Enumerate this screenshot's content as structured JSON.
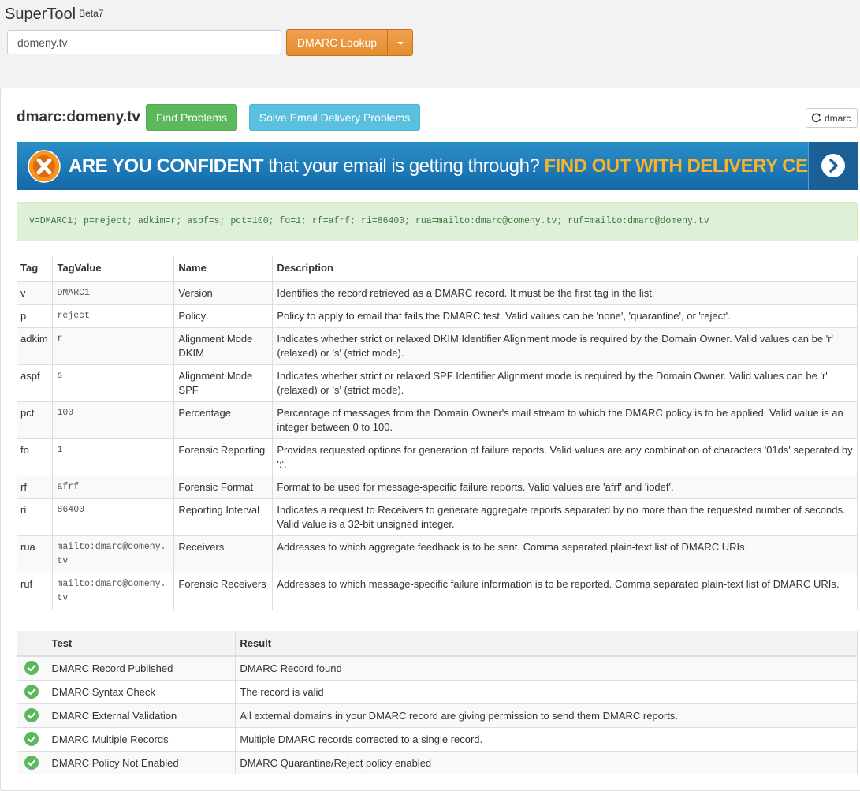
{
  "app": {
    "name": "SuperTool",
    "badge": "Beta7"
  },
  "search": {
    "value": "domeny.tv",
    "button_label": "DMARC Lookup"
  },
  "record_title": "dmarc:domeny.tv",
  "buttons": {
    "find_problems": "Find Problems",
    "solve_email": "Solve Email Delivery Problems",
    "refresh": "dmarc"
  },
  "banner": {
    "bold_text": "ARE YOU CONFIDENT",
    "normal_text": " that your email is getting through? ",
    "cta_text": "FIND OUT WITH DELIVERY CENTER"
  },
  "record_text": "v=DMARC1; p=reject; adkim=r; aspf=s; pct=100; fo=1; rf=afrf; ri=86400; rua=mailto:dmarc@domeny.tv; ruf=mailto:dmarc@domeny.tv",
  "tag_table": {
    "headers": [
      "Tag",
      "TagValue",
      "Name",
      "Description"
    ],
    "rows": [
      {
        "tag": "v",
        "value": "DMARC1",
        "name": "Version",
        "description": "Identifies the record retrieved as a DMARC record. It must be the first tag in the list."
      },
      {
        "tag": "p",
        "value": "reject",
        "name": "Policy",
        "description": "Policy to apply to email that fails the DMARC test. Valid values can be 'none', 'quarantine', or 'reject'."
      },
      {
        "tag": "adkim",
        "value": "r",
        "name": "Alignment Mode DKIM",
        "description": "Indicates whether strict or relaxed DKIM Identifier Alignment mode is required by the Domain Owner. Valid values can be 'r' (relaxed) or 's' (strict mode)."
      },
      {
        "tag": "aspf",
        "value": "s",
        "name": "Alignment Mode SPF",
        "description": "Indicates whether strict or relaxed SPF Identifier Alignment mode is required by the Domain Owner. Valid values can be 'r' (relaxed) or 's' (strict mode)."
      },
      {
        "tag": "pct",
        "value": "100",
        "name": "Percentage",
        "description": "Percentage of messages from the Domain Owner's mail stream to which the DMARC policy is to be applied. Valid value is an integer between 0 to 100."
      },
      {
        "tag": "fo",
        "value": "1",
        "name": "Forensic Reporting",
        "description": "Provides requested options for generation of failure reports. Valid values are any combination of characters '01ds' seperated by ':'."
      },
      {
        "tag": "rf",
        "value": "afrf",
        "name": "Forensic Format",
        "description": "Format to be used for message-specific failure reports. Valid values are 'afrf' and 'iodef'."
      },
      {
        "tag": "ri",
        "value": "86400",
        "name": "Reporting Interval",
        "description": "Indicates a request to Receivers to generate aggregate reports separated by no more than the requested number of seconds. Valid value is a 32-bit unsigned integer."
      },
      {
        "tag": "rua",
        "value": "mailto:dmarc@domeny.tv",
        "name": "Receivers",
        "description": "Addresses to which aggregate feedback is to be sent. Comma separated plain-text list of DMARC URIs."
      },
      {
        "tag": "ruf",
        "value": "mailto:dmarc@domeny.tv",
        "name": "Forensic Receivers",
        "description": "Addresses to which message-specific failure information is to be reported. Comma separated plain-text list of DMARC URIs."
      }
    ]
  },
  "test_table": {
    "headers": [
      "",
      "Test",
      "Result"
    ],
    "rows": [
      {
        "status": "check-icon",
        "test": "DMARC Record Published",
        "result": "DMARC Record found"
      },
      {
        "status": "check-icon",
        "test": "DMARC Syntax Check",
        "result": "The record is valid"
      },
      {
        "status": "check-icon",
        "test": "DMARC External Validation",
        "result": "All external domains in your DMARC record are giving permission to send them DMARC reports."
      },
      {
        "status": "check-icon",
        "test": "DMARC Multiple Records",
        "result": "Multiple DMARC records corrected to a single record."
      },
      {
        "status": "check-icon",
        "test": "DMARC Policy Not Enabled",
        "result": "DMARC Quarantine/Reject policy enabled"
      }
    ]
  },
  "colors": {
    "accent_orange": "#e38d2e",
    "success_green": "#5cb85c",
    "info_blue": "#5bc0de",
    "banner_blue": "#1e7bb8",
    "banner_orange": "#f7b32b"
  }
}
